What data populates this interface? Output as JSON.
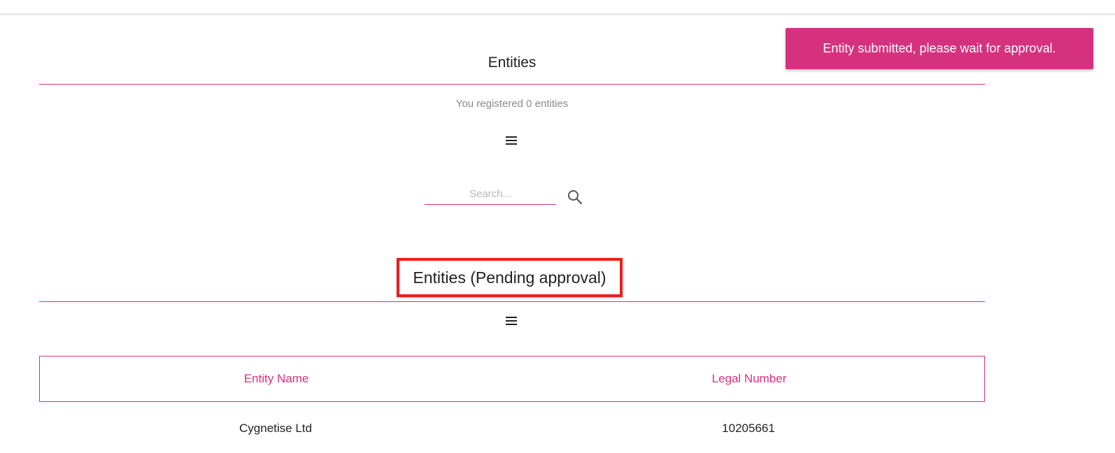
{
  "toast": {
    "message": "Entity submitted, please wait for approval."
  },
  "entities": {
    "title": "Entities",
    "count_text": "You registered 0 entities",
    "menu_icon": "menu-icon"
  },
  "search": {
    "placeholder": "Search...",
    "value": "",
    "icon": "search-icon"
  },
  "pending": {
    "title": "Entities (Pending approval)",
    "menu_icon": "menu-icon",
    "table": {
      "columns": [
        "Entity Name",
        "Legal Number"
      ],
      "rows": [
        [
          "Cygnetise Ltd",
          "10205661"
        ]
      ]
    }
  },
  "colors": {
    "accent": "#d6317f",
    "highlight": "#ee1c1c"
  }
}
